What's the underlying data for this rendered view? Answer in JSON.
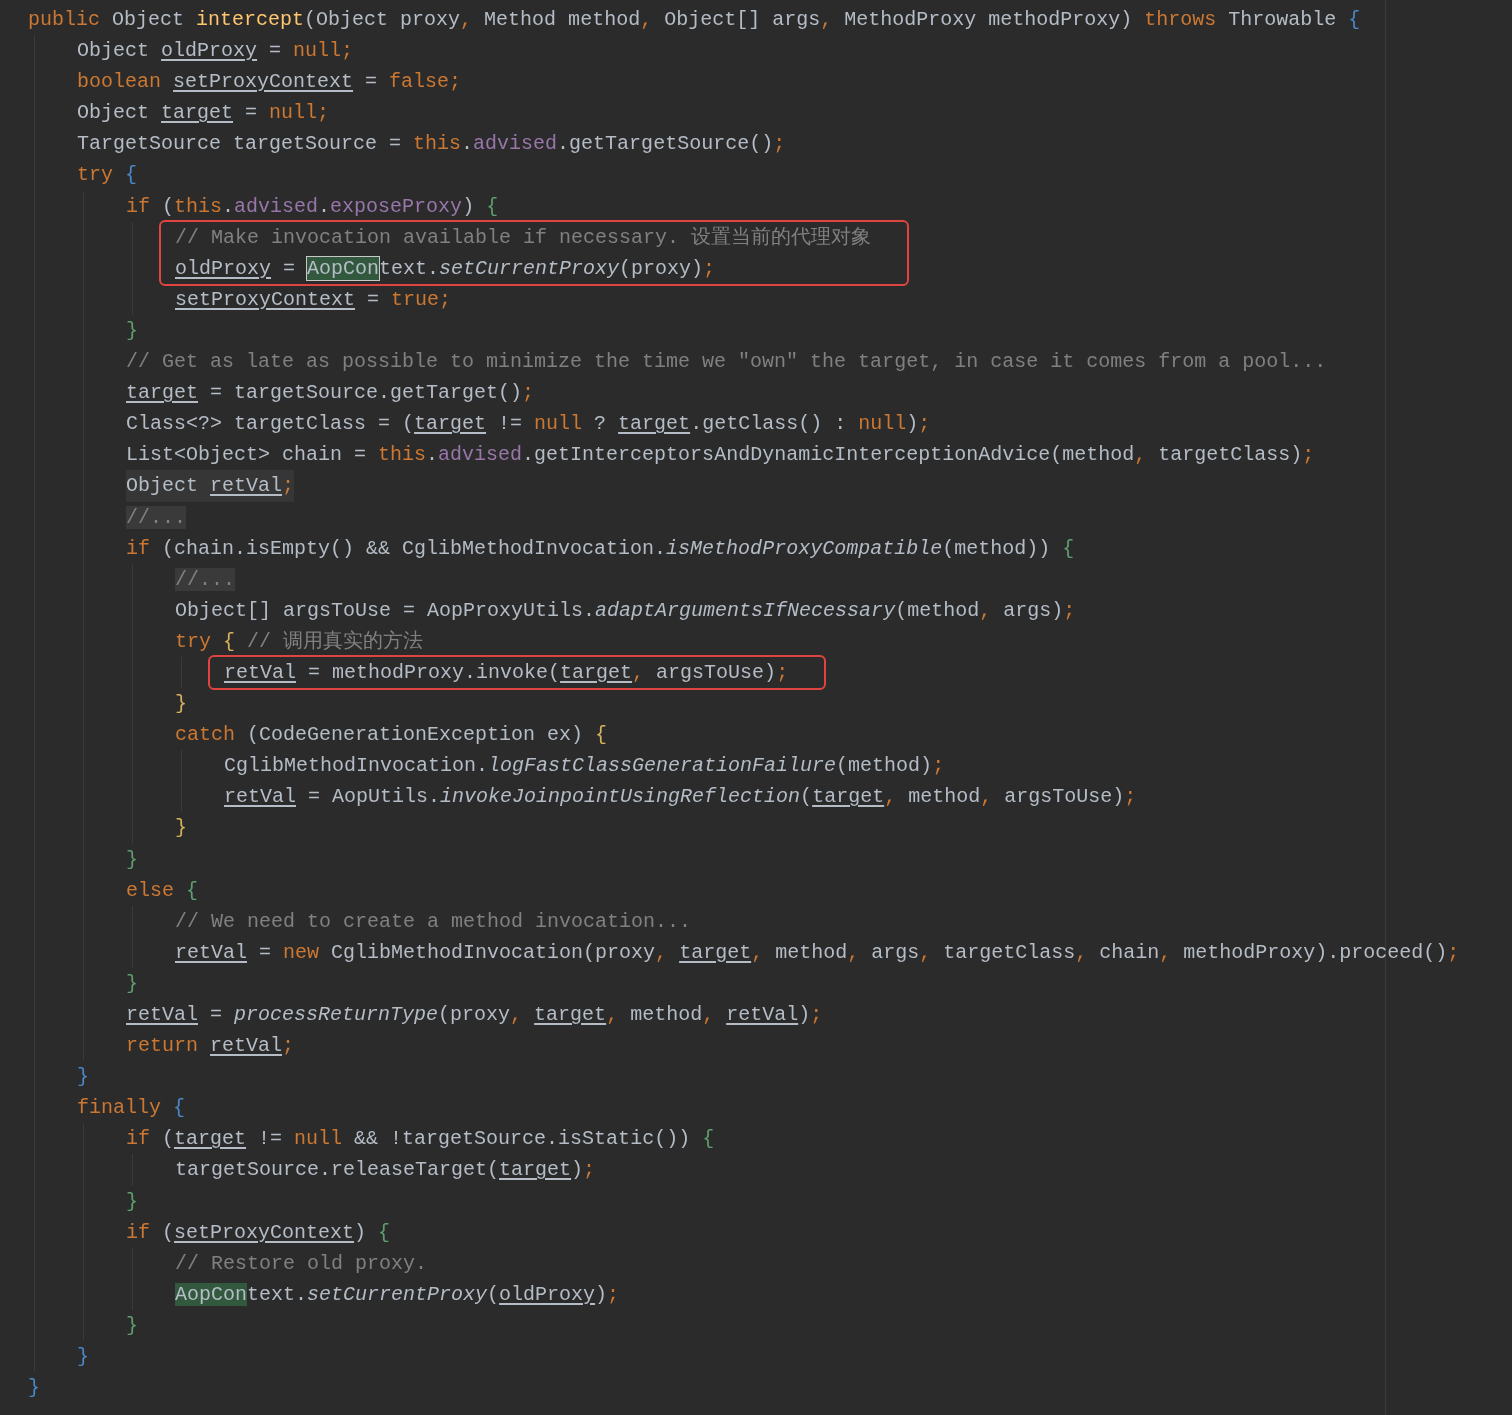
{
  "code": [
    {
      "kind": "line",
      "tokens": [
        {
          "text": "public",
          "kind": "kw"
        },
        {
          "text": " Object ",
          "kind": "text"
        },
        {
          "text": "intercept",
          "kind": "decl"
        },
        {
          "text": "(Object proxy",
          "kind": "text"
        },
        {
          "text": ", ",
          "kind": "punct"
        },
        {
          "text": "Method method",
          "kind": "text"
        },
        {
          "text": ", ",
          "kind": "punct"
        },
        {
          "text": "Object[] args",
          "kind": "text"
        },
        {
          "text": ", ",
          "kind": "punct"
        },
        {
          "text": "MethodProxy methodProxy) ",
          "kind": "text"
        },
        {
          "text": "throws",
          "kind": "kw"
        },
        {
          "text": " Throwable ",
          "kind": "text"
        },
        {
          "text": "{",
          "kind": "brace",
          "color": "#4a88c7"
        }
      ],
      "children": [
        {
          "kind": "line",
          "tokens": [
            {
              "text": "Object ",
              "kind": "text"
            },
            {
              "text": "oldProxy",
              "kind": "var"
            },
            {
              "text": " = ",
              "kind": "text"
            },
            {
              "text": "null",
              "kind": "kw"
            },
            {
              "text": ";",
              "kind": "punct"
            }
          ]
        },
        {
          "kind": "line",
          "tokens": [
            {
              "text": "boolean ",
              "kind": "kw"
            },
            {
              "text": "setProxyContext",
              "kind": "var"
            },
            {
              "text": " = ",
              "kind": "text"
            },
            {
              "text": "false",
              "kind": "kw"
            },
            {
              "text": ";",
              "kind": "punct"
            }
          ]
        },
        {
          "kind": "line",
          "tokens": [
            {
              "text": "Object ",
              "kind": "text"
            },
            {
              "text": "target",
              "kind": "var"
            },
            {
              "text": " = ",
              "kind": "text"
            },
            {
              "text": "null",
              "kind": "kw"
            },
            {
              "text": ";",
              "kind": "punct"
            }
          ]
        },
        {
          "kind": "line",
          "tokens": [
            {
              "text": "TargetSource targetSource = ",
              "kind": "text"
            },
            {
              "text": "this",
              "kind": "kw"
            },
            {
              "text": ".",
              "kind": "text"
            },
            {
              "text": "advised",
              "kind": "field"
            },
            {
              "text": ".getTargetSource()",
              "kind": "text"
            },
            {
              "text": ";",
              "kind": "punct"
            }
          ]
        },
        {
          "kind": "line",
          "tokens": [
            {
              "text": "try ",
              "kind": "kw"
            },
            {
              "text": "{",
              "kind": "brace",
              "color": "#4a88c7"
            }
          ],
          "children": [
            {
              "kind": "line",
              "tokens": [
                {
                  "text": "if",
                  "kind": "kw"
                },
                {
                  "text": " (",
                  "kind": "text"
                },
                {
                  "text": "this",
                  "kind": "kw"
                },
                {
                  "text": ".",
                  "kind": "text"
                },
                {
                  "text": "advised",
                  "kind": "field"
                },
                {
                  "text": ".",
                  "kind": "text"
                },
                {
                  "text": "exposeProxy",
                  "kind": "field"
                },
                {
                  "text": ") ",
                  "kind": "text"
                },
                {
                  "text": "{",
                  "kind": "brace",
                  "color": "#5f9e6e"
                }
              ],
              "children": [
                {
                  "kind": "callout",
                  "lines": [
                    {
                      "kind": "line",
                      "tokens": [
                        {
                          "text": "// Make invocation available if necessary. 设置当前的代理对象",
                          "kind": "comment"
                        }
                      ]
                    },
                    {
                      "kind": "line",
                      "tokens": [
                        {
                          "text": "oldProxy",
                          "kind": "var"
                        },
                        {
                          "text": " = ",
                          "kind": "text"
                        },
                        {
                          "text": "AopCon",
                          "kind": "selection"
                        },
                        {
                          "text": "text.",
                          "kind": "text"
                        },
                        {
                          "text": "setCurrentProxy",
                          "kind": "static"
                        },
                        {
                          "text": "(proxy)",
                          "kind": "text"
                        },
                        {
                          "text": ";",
                          "kind": "punct"
                        }
                      ]
                    }
                  ]
                },
                {
                  "kind": "line",
                  "tokens": [
                    {
                      "text": "setProxyContext",
                      "kind": "var"
                    },
                    {
                      "text": " = ",
                      "kind": "text"
                    },
                    {
                      "text": "true",
                      "kind": "kw"
                    },
                    {
                      "text": ";",
                      "kind": "punct"
                    }
                  ]
                }
              ]
            },
            {
              "kind": "line",
              "tokens": [
                {
                  "text": "}",
                  "kind": "brace",
                  "color": "#5f9e6e"
                }
              ]
            },
            {
              "kind": "line",
              "tokens": [
                {
                  "text": "// Get as late as possible to minimize the time we \"own\" the target, in case it comes from a pool...",
                  "kind": "comment"
                }
              ]
            },
            {
              "kind": "line",
              "tokens": [
                {
                  "text": "target",
                  "kind": "var"
                },
                {
                  "text": " = targetSource.getTarget()",
                  "kind": "text"
                },
                {
                  "text": ";",
                  "kind": "punct"
                }
              ]
            },
            {
              "kind": "line",
              "tokens": [
                {
                  "text": "Class<?> targetClass = (",
                  "kind": "text"
                },
                {
                  "text": "target",
                  "kind": "var"
                },
                {
                  "text": " != ",
                  "kind": "text"
                },
                {
                  "text": "null",
                  "kind": "kw"
                },
                {
                  "text": " ? ",
                  "kind": "text"
                },
                {
                  "text": "target",
                  "kind": "var"
                },
                {
                  "text": ".getClass() : ",
                  "kind": "text"
                },
                {
                  "text": "null",
                  "kind": "kw"
                },
                {
                  "text": ")",
                  "kind": "text"
                },
                {
                  "text": ";",
                  "kind": "punct"
                }
              ]
            },
            {
              "kind": "line",
              "tokens": [
                {
                  "text": "List<Object> chain = ",
                  "kind": "text"
                },
                {
                  "text": "this",
                  "kind": "kw"
                },
                {
                  "text": ".",
                  "kind": "text"
                },
                {
                  "text": "advised",
                  "kind": "field"
                },
                {
                  "text": ".getInterceptorsAndDynamicInterceptionAdvice(method",
                  "kind": "text"
                },
                {
                  "text": ", ",
                  "kind": "punct"
                },
                {
                  "text": "targetClass)",
                  "kind": "text"
                },
                {
                  "text": ";",
                  "kind": "punct"
                }
              ]
            },
            {
              "kind": "line",
              "current": true,
              "tokens": [
                {
                  "text": "Object ",
                  "kind": "text"
                },
                {
                  "text": "retVal",
                  "kind": "var"
                },
                {
                  "text": ";",
                  "kind": "punct"
                }
              ]
            },
            {
              "kind": "line",
              "tokens": [
                {
                  "text": "//...",
                  "kind": "fold"
                }
              ]
            },
            {
              "kind": "line",
              "tokens": [
                {
                  "text": "if",
                  "kind": "kw"
                },
                {
                  "text": " (chain.isEmpty() && CglibMethodInvocation.",
                  "kind": "text"
                },
                {
                  "text": "isMethodProxyCompatible",
                  "kind": "static"
                },
                {
                  "text": "(method)) ",
                  "kind": "text"
                },
                {
                  "text": "{",
                  "kind": "brace",
                  "color": "#5f9e6e"
                }
              ],
              "children": [
                {
                  "kind": "line",
                  "tokens": [
                    {
                      "text": "//...",
                      "kind": "fold"
                    }
                  ]
                },
                {
                  "kind": "line",
                  "tokens": [
                    {
                      "text": "Object[] argsToUse = AopProxyUtils.",
                      "kind": "text"
                    },
                    {
                      "text": "adaptArgumentsIfNecessary",
                      "kind": "static"
                    },
                    {
                      "text": "(method",
                      "kind": "text"
                    },
                    {
                      "text": ", ",
                      "kind": "punct"
                    },
                    {
                      "text": "args)",
                      "kind": "text"
                    },
                    {
                      "text": ";",
                      "kind": "punct"
                    }
                  ]
                },
                {
                  "kind": "line",
                  "tokens": [
                    {
                      "text": "try ",
                      "kind": "kw"
                    },
                    {
                      "text": "{",
                      "kind": "brace",
                      "color": "#d6b25e"
                    },
                    {
                      "text": " // 调用真实的方法",
                      "kind": "comment"
                    }
                  ],
                  "children": [
                    {
                      "kind": "callout",
                      "lines": [
                        {
                          "kind": "line",
                          "tokens": [
                            {
                              "text": "retVal",
                              "kind": "var"
                            },
                            {
                              "text": " = methodProxy.invoke(",
                              "kind": "text"
                            },
                            {
                              "text": "target",
                              "kind": "var"
                            },
                            {
                              "text": ", ",
                              "kind": "punct"
                            },
                            {
                              "text": "argsToUse)",
                              "kind": "text"
                            },
                            {
                              "text": ";",
                              "kind": "punct"
                            }
                          ]
                        }
                      ]
                    }
                  ]
                },
                {
                  "kind": "line",
                  "tokens": [
                    {
                      "text": "}",
                      "kind": "brace",
                      "color": "#d6b25e"
                    }
                  ]
                },
                {
                  "kind": "line",
                  "tokens": [
                    {
                      "text": "catch",
                      "kind": "kw"
                    },
                    {
                      "text": " (CodeGenerationException ex) ",
                      "kind": "text"
                    },
                    {
                      "text": "{",
                      "kind": "brace",
                      "color": "#d6b25e"
                    }
                  ],
                  "children": [
                    {
                      "kind": "line",
                      "tokens": [
                        {
                          "text": "CglibMethodInvocation.",
                          "kind": "text"
                        },
                        {
                          "text": "logFastClassGenerationFailure",
                          "kind": "static"
                        },
                        {
                          "text": "(method)",
                          "kind": "text"
                        },
                        {
                          "text": ";",
                          "kind": "punct"
                        }
                      ]
                    },
                    {
                      "kind": "line",
                      "tokens": [
                        {
                          "text": "retVal",
                          "kind": "var"
                        },
                        {
                          "text": " = AopUtils.",
                          "kind": "text"
                        },
                        {
                          "text": "invokeJoinpointUsingReflection",
                          "kind": "static"
                        },
                        {
                          "text": "(",
                          "kind": "text"
                        },
                        {
                          "text": "target",
                          "kind": "var"
                        },
                        {
                          "text": ", ",
                          "kind": "punct"
                        },
                        {
                          "text": "method",
                          "kind": "text"
                        },
                        {
                          "text": ", ",
                          "kind": "punct"
                        },
                        {
                          "text": "argsToUse)",
                          "kind": "text"
                        },
                        {
                          "text": ";",
                          "kind": "punct"
                        }
                      ]
                    }
                  ]
                },
                {
                  "kind": "line",
                  "tokens": [
                    {
                      "text": "}",
                      "kind": "brace",
                      "color": "#d6b25e"
                    }
                  ]
                }
              ]
            },
            {
              "kind": "line",
              "tokens": [
                {
                  "text": "}",
                  "kind": "brace",
                  "color": "#5f9e6e"
                }
              ]
            },
            {
              "kind": "line",
              "tokens": [
                {
                  "text": "else ",
                  "kind": "kw"
                },
                {
                  "text": "{",
                  "kind": "brace",
                  "color": "#5f9e6e"
                }
              ],
              "children": [
                {
                  "kind": "line",
                  "tokens": [
                    {
                      "text": "// We need to create a method invocation...",
                      "kind": "comment"
                    }
                  ]
                },
                {
                  "kind": "line",
                  "tokens": [
                    {
                      "text": "retVal",
                      "kind": "var"
                    },
                    {
                      "text": " = ",
                      "kind": "text"
                    },
                    {
                      "text": "new",
                      "kind": "kw"
                    },
                    {
                      "text": " CglibMethodInvocation(proxy",
                      "kind": "text"
                    },
                    {
                      "text": ", ",
                      "kind": "punct"
                    },
                    {
                      "text": "target",
                      "kind": "var"
                    },
                    {
                      "text": ", ",
                      "kind": "punct"
                    },
                    {
                      "text": "method",
                      "kind": "text"
                    },
                    {
                      "text": ", ",
                      "kind": "punct"
                    },
                    {
                      "text": "args",
                      "kind": "text"
                    },
                    {
                      "text": ", ",
                      "kind": "punct"
                    },
                    {
                      "text": "targetClass",
                      "kind": "text"
                    },
                    {
                      "text": ", ",
                      "kind": "punct"
                    },
                    {
                      "text": "chain",
                      "kind": "text"
                    },
                    {
                      "text": ", ",
                      "kind": "punct"
                    },
                    {
                      "text": "methodProxy).proceed()",
                      "kind": "text"
                    },
                    {
                      "text": ";",
                      "kind": "punct"
                    }
                  ]
                }
              ]
            },
            {
              "kind": "line",
              "tokens": [
                {
                  "text": "}",
                  "kind": "brace",
                  "color": "#5f9e6e"
                }
              ]
            },
            {
              "kind": "line",
              "tokens": [
                {
                  "text": "retVal",
                  "kind": "var"
                },
                {
                  "text": " = ",
                  "kind": "text"
                },
                {
                  "text": "processReturnType",
                  "kind": "static"
                },
                {
                  "text": "(proxy",
                  "kind": "text"
                },
                {
                  "text": ", ",
                  "kind": "punct"
                },
                {
                  "text": "target",
                  "kind": "var"
                },
                {
                  "text": ", ",
                  "kind": "punct"
                },
                {
                  "text": "method",
                  "kind": "text"
                },
                {
                  "text": ", ",
                  "kind": "punct"
                },
                {
                  "text": "retVal",
                  "kind": "var"
                },
                {
                  "text": ")",
                  "kind": "text"
                },
                {
                  "text": ";",
                  "kind": "punct"
                }
              ]
            },
            {
              "kind": "line",
              "tokens": [
                {
                  "text": "return ",
                  "kind": "kw"
                },
                {
                  "text": "retVal",
                  "kind": "var"
                },
                {
                  "text": ";",
                  "kind": "punct"
                }
              ]
            }
          ]
        },
        {
          "kind": "line",
          "tokens": [
            {
              "text": "}",
              "kind": "brace",
              "color": "#4a88c7"
            }
          ]
        },
        {
          "kind": "line",
          "tokens": [
            {
              "text": "finally ",
              "kind": "kw"
            },
            {
              "text": "{",
              "kind": "brace",
              "color": "#4a88c7"
            }
          ],
          "children": [
            {
              "kind": "line",
              "tokens": [
                {
                  "text": "if",
                  "kind": "kw"
                },
                {
                  "text": " (",
                  "kind": "text"
                },
                {
                  "text": "target",
                  "kind": "var"
                },
                {
                  "text": " != ",
                  "kind": "text"
                },
                {
                  "text": "null",
                  "kind": "kw"
                },
                {
                  "text": " && !targetSource.isStatic()) ",
                  "kind": "text"
                },
                {
                  "text": "{",
                  "kind": "brace",
                  "color": "#5f9e6e"
                }
              ],
              "children": [
                {
                  "kind": "line",
                  "tokens": [
                    {
                      "text": "targetSource.releaseTarget(",
                      "kind": "text"
                    },
                    {
                      "text": "target",
                      "kind": "var"
                    },
                    {
                      "text": ")",
                      "kind": "text"
                    },
                    {
                      "text": ";",
                      "kind": "punct"
                    }
                  ]
                }
              ]
            },
            {
              "kind": "line",
              "tokens": [
                {
                  "text": "}",
                  "kind": "brace",
                  "color": "#5f9e6e"
                }
              ]
            },
            {
              "kind": "line",
              "tokens": [
                {
                  "text": "if",
                  "kind": "kw"
                },
                {
                  "text": " (",
                  "kind": "text"
                },
                {
                  "text": "setProxyContext",
                  "kind": "var"
                },
                {
                  "text": ") ",
                  "kind": "text"
                },
                {
                  "text": "{",
                  "kind": "brace",
                  "color": "#5f9e6e"
                }
              ],
              "children": [
                {
                  "kind": "line",
                  "tokens": [
                    {
                      "text": "// Restore old proxy.",
                      "kind": "comment"
                    }
                  ]
                },
                {
                  "kind": "line",
                  "tokens": [
                    {
                      "text": "AopCon",
                      "kind": "match"
                    },
                    {
                      "text": "text.",
                      "kind": "text"
                    },
                    {
                      "text": "setCurrentProxy",
                      "kind": "static"
                    },
                    {
                      "text": "(",
                      "kind": "text"
                    },
                    {
                      "text": "oldProxy",
                      "kind": "var"
                    },
                    {
                      "text": ")",
                      "kind": "text"
                    },
                    {
                      "text": ";",
                      "kind": "punct"
                    }
                  ]
                }
              ]
            },
            {
              "kind": "line",
              "tokens": [
                {
                  "text": "}",
                  "kind": "brace",
                  "color": "#5f9e6e"
                }
              ]
            }
          ]
        },
        {
          "kind": "line",
          "tokens": [
            {
              "text": "}",
              "kind": "brace",
              "color": "#4a88c7"
            }
          ]
        }
      ]
    },
    {
      "kind": "line",
      "tokens": [
        {
          "text": "}",
          "kind": "brace",
          "color": "#4a88c7"
        }
      ]
    }
  ]
}
